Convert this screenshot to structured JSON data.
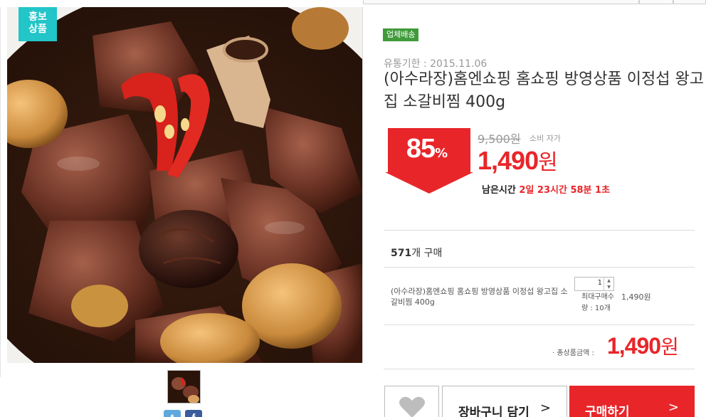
{
  "promo_badge": {
    "line1": "홍보",
    "line2": "상품"
  },
  "delivery_badge": "업체배송",
  "expiry": "유통기한 : 2015.11.06",
  "title": "(아수라장)홈엔쇼핑 홈쇼핑 방영상품 이정섭 왕고집 소갈비찜 400g",
  "discount": {
    "value": "85",
    "unit": "%"
  },
  "original_price": "9,500원",
  "consumer_label": "소비 자가",
  "sale_price": {
    "amount": "1,490",
    "unit": "원"
  },
  "time_left": {
    "label": "남은시간",
    "value": "2일 23시간 58분 1초"
  },
  "sold": {
    "count": "571",
    "suffix": "개 구매"
  },
  "option": {
    "name": "(아수라장)홈엔쇼핑 홈쇼핑 방영상품 이정섭 왕고집 소갈비찜 400g",
    "quantity": "1",
    "max_label": "최대구매수량 : 10개",
    "price": "1,490원"
  },
  "total": {
    "label": "· 총상품금액 :",
    "amount": "1,490",
    "unit": "원"
  },
  "buttons": {
    "cart": "장바구니 담기",
    "buy": "구매하기"
  },
  "colors": {
    "accent": "#e8262a",
    "promo": "#22c5c8",
    "delivery": "#3f9b3a"
  },
  "icons": [
    "heart-icon",
    "twitter-icon",
    "facebook-icon",
    "chevron-right-icon"
  ]
}
